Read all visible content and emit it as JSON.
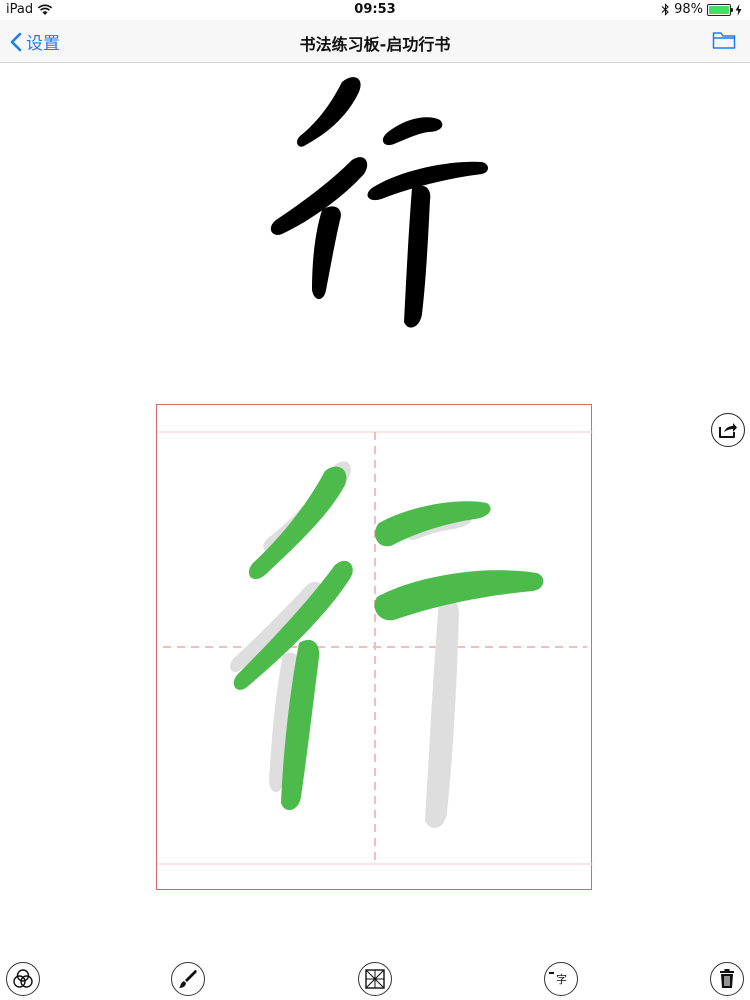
{
  "status_bar": {
    "device": "iPad",
    "time": "09:53",
    "battery_text": "98%",
    "battery_level": 0.98,
    "battery_color": "#4cd964"
  },
  "nav": {
    "back_label": "设置",
    "title": "书法练习板-启功行书",
    "right_icon": "folder-icon"
  },
  "reference": {
    "character": "行"
  },
  "toolbar": {
    "icons": [
      "color-circles-icon",
      "brush-icon",
      "grid-icon",
      "single-char-icon",
      "trash-icon"
    ],
    "single_char_label": "字"
  },
  "colors": {
    "accent": "#1a7cf5",
    "grid_border": "#e06666",
    "grid_dash": "#f4bcbc",
    "stroke_green": "#4cbb4c",
    "shadow_gray": "#dcdcdc"
  }
}
